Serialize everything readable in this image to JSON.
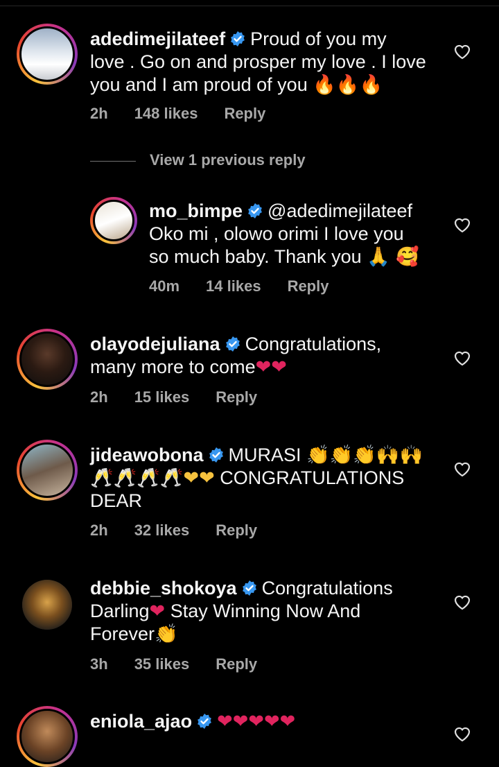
{
  "comments": [
    {
      "username": "adedimejilateef",
      "lines": [
        "Proud of you my",
        "love . Go on and prosper my love . I love",
        "you and I am proud of you"
      ],
      "emojis": "🔥🔥🔥",
      "time": "2h",
      "likes": "148 likes",
      "reply": "Reply"
    },
    {
      "username": "mo_bimpe",
      "lines": [
        "@adedimejilateef",
        "Oko mi , olowo orimi I love you",
        "so much baby. Thank you"
      ],
      "emojis": "🙏 🥰",
      "time": "40m",
      "likes": "14 likes",
      "reply": "Reply"
    },
    {
      "username": "olayodejuliana",
      "lines": [
        "Congratulations,",
        "many more to come"
      ],
      "emojis": "❤❤",
      "time": "2h",
      "likes": "15 likes",
      "reply": "Reply"
    },
    {
      "username": "jideawobona",
      "lines": [
        "MURASI",
        "CONGRATULATIONS",
        "DEAR"
      ],
      "emojis1": "👏👏👏🙌🙌",
      "emojis2": "🥂🥂🥂🥂❤❤",
      "time": "2h",
      "likes": "32 likes",
      "reply": "Reply"
    },
    {
      "username": "debbie_shokoya",
      "lines": [
        "Congratulations",
        "Darling",
        "Stay Winning Now And",
        "Forever"
      ],
      "emoji_heart": "❤",
      "emoji_clap": "👏",
      "time": "3h",
      "likes": "35 likes",
      "reply": "Reply"
    },
    {
      "username": "eniola_ajao",
      "emojis": "❤❤❤❤❤"
    }
  ],
  "view_replies": "View 1 previous reply",
  "colors": {
    "verified": "#3897f0",
    "meta": "#a8a8a8",
    "background": "#000000"
  },
  "icons": {
    "like": "heart-outline-icon",
    "verified": "verified-badge-icon"
  }
}
